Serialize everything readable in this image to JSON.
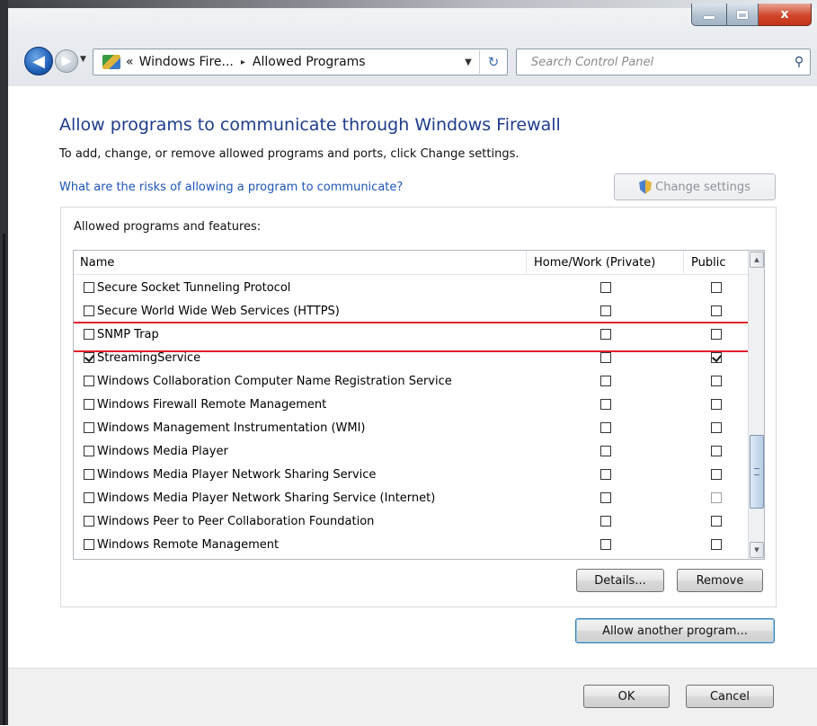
{
  "window": {
    "controls": {
      "minimize": "minimize",
      "maximize": "maximize",
      "close": "x"
    }
  },
  "nav": {
    "back_glyph": "◀",
    "forward_glyph": "▶",
    "breadcrumbs": [
      "Windows Fire...",
      "Allowed Programs"
    ],
    "breadcrumb_prefix": "«",
    "breadcrumb_separator": "▸",
    "search_placeholder": "Search Control Panel"
  },
  "content": {
    "title": "Allow programs to communicate through Windows Firewall",
    "subtitle": "To add, change, or remove allowed programs and ports, click Change settings.",
    "risks_link": "What are the risks of allowing a program to communicate?",
    "change_settings_label": "Change settings",
    "group_label": "Allowed programs and features:",
    "columns": {
      "name": "Name",
      "home": "Home/Work (Private)",
      "public": "Public"
    },
    "rows": [
      {
        "name": "Secure Socket Tunneling Protocol",
        "enabled": false,
        "home": false,
        "public": false
      },
      {
        "name": "Secure World Wide Web Services (HTTPS)",
        "enabled": false,
        "home": false,
        "public": false
      },
      {
        "name": "SNMP Trap",
        "enabled": false,
        "home": false,
        "public": false
      },
      {
        "name": "StreamingService",
        "enabled": true,
        "home": false,
        "public": true,
        "highlighted": true
      },
      {
        "name": "Windows Collaboration Computer Name Registration Service",
        "enabled": false,
        "home": false,
        "public": false
      },
      {
        "name": "Windows Firewall Remote Management",
        "enabled": false,
        "home": false,
        "public": false
      },
      {
        "name": "Windows Management Instrumentation (WMI)",
        "enabled": false,
        "home": false,
        "public": false
      },
      {
        "name": "Windows Media Player",
        "enabled": false,
        "home": false,
        "public": false
      },
      {
        "name": "Windows Media Player Network Sharing Service",
        "enabled": false,
        "home": false,
        "public": false
      },
      {
        "name": "Windows Media Player Network Sharing Service (Internet)",
        "enabled": false,
        "home": false,
        "public": false,
        "public_disabled": true
      },
      {
        "name": "Windows Peer to Peer Collaboration Foundation",
        "enabled": false,
        "home": false,
        "public": false
      },
      {
        "name": "Windows Remote Management",
        "enabled": false,
        "home": false,
        "public": false
      }
    ],
    "details_label": "Details...",
    "remove_label": "Remove",
    "allow_another_label": "Allow another program..."
  },
  "footer": {
    "ok_label": "OK",
    "cancel_label": "Cancel"
  },
  "colors": {
    "title_blue": "#1e3c8c",
    "link_blue": "#1c55b8",
    "highlight_red": "#e0212a"
  }
}
